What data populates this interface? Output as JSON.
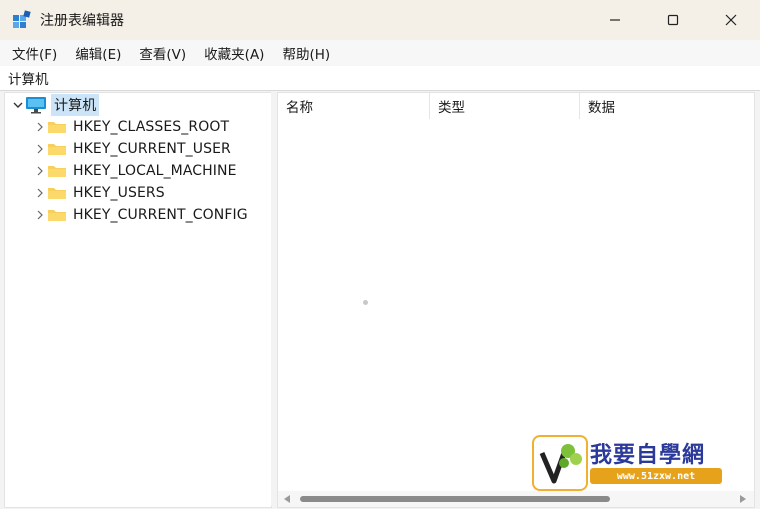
{
  "window": {
    "title": "注册表编辑器",
    "icon": "registry-editor-icon",
    "buttons": [
      "minimize-icon",
      "maximize-icon",
      "close-icon"
    ]
  },
  "menubar": {
    "items": [
      "文件(F)",
      "编辑(E)",
      "查看(V)",
      "收藏夹(A)",
      "帮助(H)"
    ]
  },
  "address": {
    "path": "计算机"
  },
  "tree": {
    "root": {
      "label": "计算机",
      "icon": "computer-icon",
      "expanded": true,
      "selected": true
    },
    "children": [
      {
        "label": "HKEY_CLASSES_ROOT",
        "icon": "folder-icon"
      },
      {
        "label": "HKEY_CURRENT_USER",
        "icon": "folder-icon"
      },
      {
        "label": "HKEY_LOCAL_MACHINE",
        "icon": "folder-icon"
      },
      {
        "label": "HKEY_USERS",
        "icon": "folder-icon"
      },
      {
        "label": "HKEY_CURRENT_CONFIG",
        "icon": "folder-icon"
      }
    ]
  },
  "list": {
    "columns": [
      "名称",
      "类型",
      "数据"
    ]
  },
  "watermark": {
    "title": "我要自學網",
    "url": "www.51zxw.net"
  },
  "colors": {
    "selection": "#cce4f7",
    "folder": "#f8cf5a",
    "titlebar": "#f4efe7"
  }
}
